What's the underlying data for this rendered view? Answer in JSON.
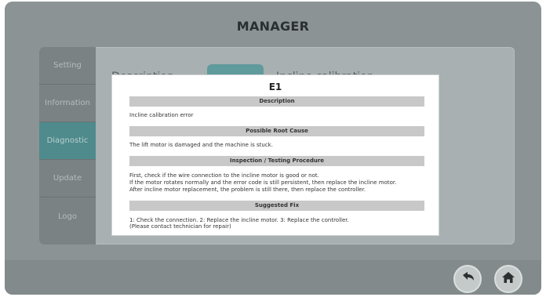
{
  "header": {
    "title": "MANAGER"
  },
  "sidebar": {
    "items": [
      {
        "label": "Setting"
      },
      {
        "label": "Information"
      },
      {
        "label": "Diagnostic"
      },
      {
        "label": "Update"
      },
      {
        "label": "Logo"
      }
    ],
    "active": "Diagnostic"
  },
  "background": {
    "text_left": "Description",
    "text_right": "Incline calibration"
  },
  "modal": {
    "title": "E1",
    "sections": [
      {
        "heading": "Description",
        "lines": [
          "Incline calibration error"
        ]
      },
      {
        "heading": "Possible Root Cause",
        "lines": [
          "The lift motor is damaged and the machine is stuck."
        ]
      },
      {
        "heading": "Inspection / Testing Procedure",
        "lines": [
          "First, check if the wire connection to the incline motor is good or not.",
          "If the motor rotates normally and the error code is still persistent, then replace the incline motor.",
          "After incline motor replacement, the problem is still there, then replace the controller."
        ]
      },
      {
        "heading": "Suggested Fix",
        "lines": [
          "1: Check the connection. 2: Replace the incline motor. 3: Replace the controller.",
          " (Please contact technician for repair)"
        ]
      }
    ]
  },
  "footer": {
    "back_icon": "back-arrow-icon",
    "home_icon": "home-icon"
  },
  "colors": {
    "screen_bg": "#8c9394",
    "active_tab": "#4f8a8c",
    "section_bar": "#c8c8c8"
  }
}
